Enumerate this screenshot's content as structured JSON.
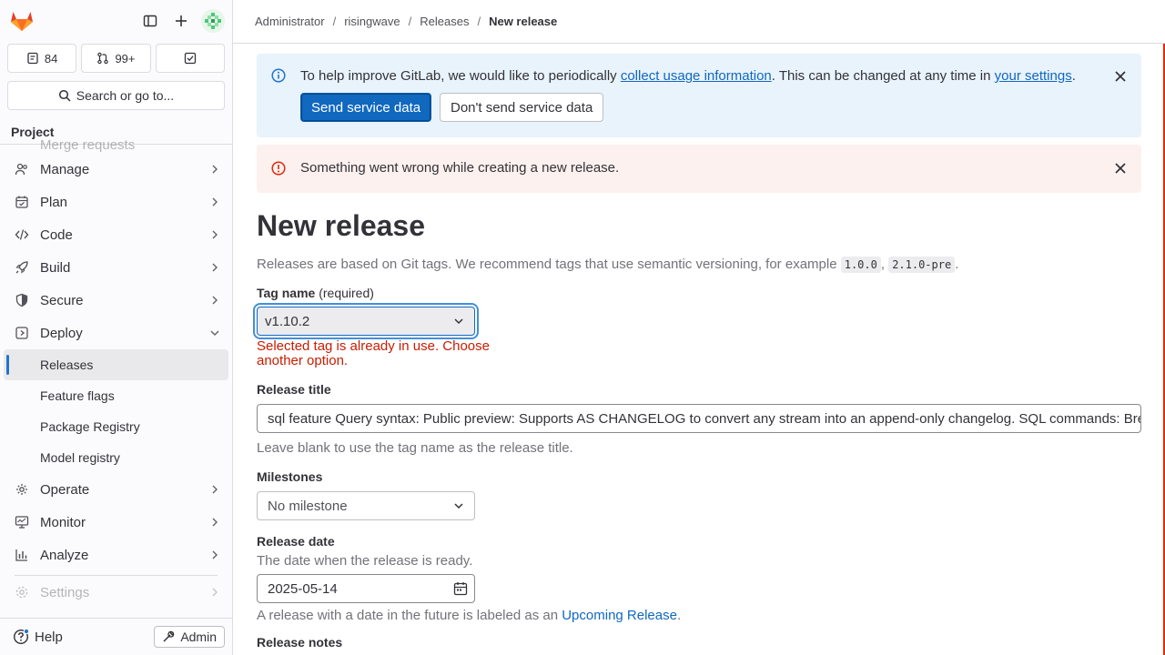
{
  "sidebar": {
    "counters": [
      {
        "icon": "issues-icon",
        "value": "84"
      },
      {
        "icon": "merge-request-icon",
        "value": "99+"
      },
      {
        "icon": "todo-icon",
        "value": ""
      }
    ],
    "search_label": "Search or go to...",
    "section_title": "Project",
    "partial_top_item": "Merge requests",
    "nav": {
      "manage": "Manage",
      "plan": "Plan",
      "code": "Code",
      "build": "Build",
      "secure": "Secure",
      "deploy": "Deploy",
      "operate": "Operate",
      "monitor": "Monitor",
      "analyze": "Analyze",
      "settings": "Settings"
    },
    "deploy_sub": {
      "releases": "Releases",
      "feature_flags": "Feature flags",
      "package_registry": "Package Registry",
      "model_registry": "Model registry"
    },
    "help_label": "Help",
    "admin_label": "Admin"
  },
  "breadcrumb": {
    "items": [
      "Administrator",
      "risingwave",
      "Releases"
    ],
    "current": "New release"
  },
  "alert_info": {
    "text_before": "To help improve GitLab, we would like to periodically ",
    "link1": "collect usage information",
    "text_mid": ". This can be changed at any time in ",
    "link2": "your settings",
    "text_after": ".",
    "primary_btn": "Send service data",
    "secondary_btn": "Don't send service data"
  },
  "alert_danger": {
    "text": "Something went wrong while creating a new release."
  },
  "page": {
    "title": "New release",
    "desc_before": "Releases are based on Git tags. We recommend tags that use semantic versioning, for example ",
    "code1": "1.0.0",
    "desc_mid": ", ",
    "code2": "2.1.0-pre",
    "desc_after": "."
  },
  "form": {
    "tag_label": "Tag name",
    "tag_required": " (required)",
    "tag_value": "v1.10.2",
    "tag_error": "Selected tag is already in use. Choose another option.",
    "title_label": "Release title",
    "title_value": "sql feature Query syntax: Public preview: Supports AS CHANGELOG to convert any stream into an append-only changelog. SQL commands: Bre",
    "title_help": "Leave blank to use the tag name as the release title.",
    "milestones_label": "Milestones",
    "milestones_value": "No milestone",
    "date_label": "Release date",
    "date_desc": "The date when the release is ready.",
    "date_value": "2025-05-14",
    "date_help_before": "A release with a date in the future is labeled as an ",
    "date_help_link": "Upcoming Release",
    "date_help_after": ".",
    "notes_label": "Release notes"
  },
  "colors": {
    "primary": "#1068bf",
    "danger": "#dd2b0e",
    "info_bg": "#e9f3fc",
    "danger_bg": "#fcf1ef"
  }
}
